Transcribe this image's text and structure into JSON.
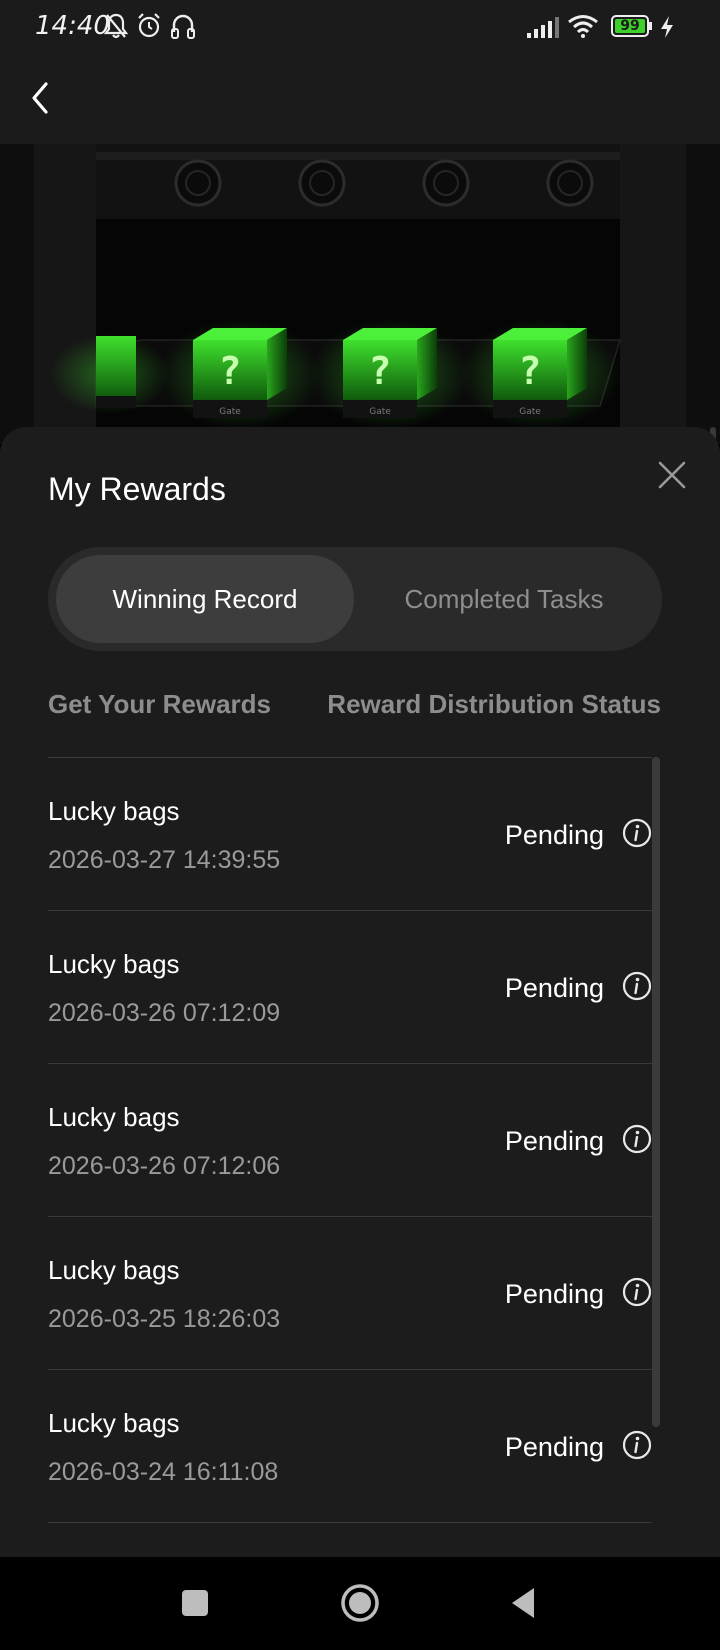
{
  "status_bar": {
    "time": "14:40",
    "battery": "99",
    "icons_left": [
      "bell-off-icon",
      "alarm-icon",
      "headphones-icon"
    ],
    "icons_right": [
      "signal-icon",
      "wifi-icon",
      "battery-icon",
      "charging-icon"
    ]
  },
  "nav": {
    "back_icon": "back-arrow-icon"
  },
  "sheet": {
    "title": "My Rewards",
    "tabs": [
      {
        "label": "Winning Record",
        "active": true
      },
      {
        "label": "Completed Tasks",
        "active": false
      }
    ],
    "columns": {
      "left": "Get Your Rewards",
      "right": "Reward Distribution Status"
    },
    "records": [
      {
        "name": "Lucky bags",
        "date": "2026-03-27 14:39:55",
        "status": "Pending"
      },
      {
        "name": "Lucky bags",
        "date": "2026-03-26 07:12:09",
        "status": "Pending"
      },
      {
        "name": "Lucky bags",
        "date": "2026-03-26 07:12:06",
        "status": "Pending"
      },
      {
        "name": "Lucky bags",
        "date": "2026-03-25 18:26:03",
        "status": "Pending"
      },
      {
        "name": "Lucky bags",
        "date": "2026-03-24 16:11:08",
        "status": "Pending"
      }
    ]
  },
  "hero": {
    "box_brand": "Gate",
    "box_symbol": "?"
  },
  "colors": {
    "background": "#1c1c1c",
    "accent_green": "#39d42a",
    "muted_text": "#8d8d8d"
  }
}
